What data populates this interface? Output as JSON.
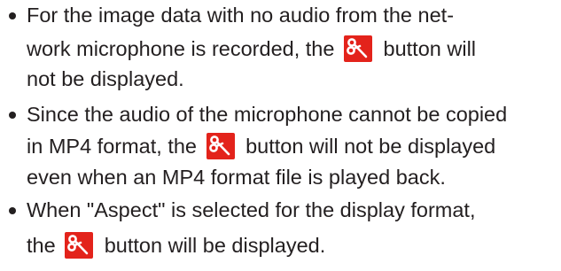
{
  "notes": [
    {
      "lines": [
        {
          "before": "For the image data with no audio from the net-"
        },
        {
          "before": "work microphone is recorded, the",
          "icon": "scissors-button-icon",
          "after": "button will"
        },
        {
          "before": "not be displayed."
        }
      ]
    },
    {
      "lines": [
        {
          "before": "Since the audio of the microphone cannot be copied"
        },
        {
          "before": "in MP4 format, the",
          "icon": "scissors-button-icon",
          "after": "button will not be displayed"
        },
        {
          "before": "even when an MP4 format file is played back."
        }
      ]
    },
    {
      "lines": [
        {
          "before": "When \"Aspect\" is selected for the display format,"
        },
        {
          "before": "the",
          "icon": "scissors-button-icon",
          "after": "button will be displayed."
        }
      ]
    }
  ],
  "colors": {
    "text": "#231f20",
    "icon_background": "#e3231b",
    "icon_glyph": "#ffffff"
  }
}
